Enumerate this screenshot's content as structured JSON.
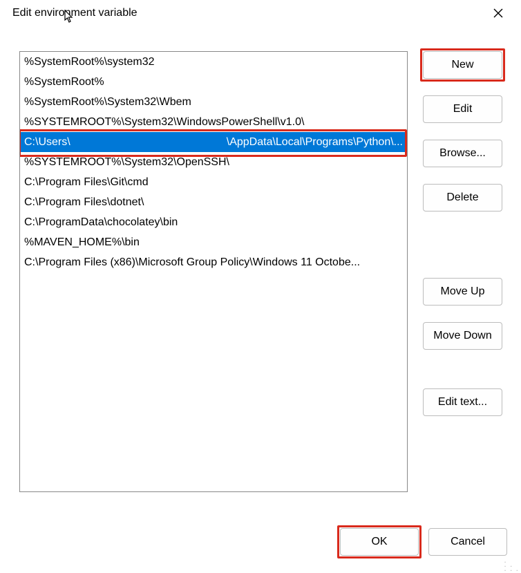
{
  "window": {
    "title": "Edit environment variable"
  },
  "list": {
    "items": [
      "%SystemRoot%\\system32",
      "%SystemRoot%",
      "%SystemRoot%\\System32\\Wbem",
      "%SYSTEMROOT%\\System32\\WindowsPowerShell\\v1.0\\",
      "C:\\Users\\                                       \\AppData\\Local\\Programs\\Python\\...",
      "%SYSTEMROOT%\\System32\\OpenSSH\\",
      "C:\\Program Files\\Git\\cmd",
      "C:\\Program Files\\dotnet\\",
      "C:\\ProgramData\\chocolatey\\bin",
      "%MAVEN_HOME%\\bin",
      "C:\\Program Files (x86)\\Microsoft Group Policy\\Windows 11 Octobe..."
    ],
    "selected_left": "C:\\Users\\",
    "selected_right": "\\AppData\\Local\\Programs\\Python\\...",
    "selected_index": 4
  },
  "buttons": {
    "new": "New",
    "edit": "Edit",
    "browse": "Browse...",
    "delete": "Delete",
    "move_up": "Move Up",
    "move_down": "Move Down",
    "edit_text": "Edit text...",
    "ok": "OK",
    "cancel": "Cancel"
  },
  "highlight_color": "#d92a1c",
  "selection_color": "#0078d7"
}
